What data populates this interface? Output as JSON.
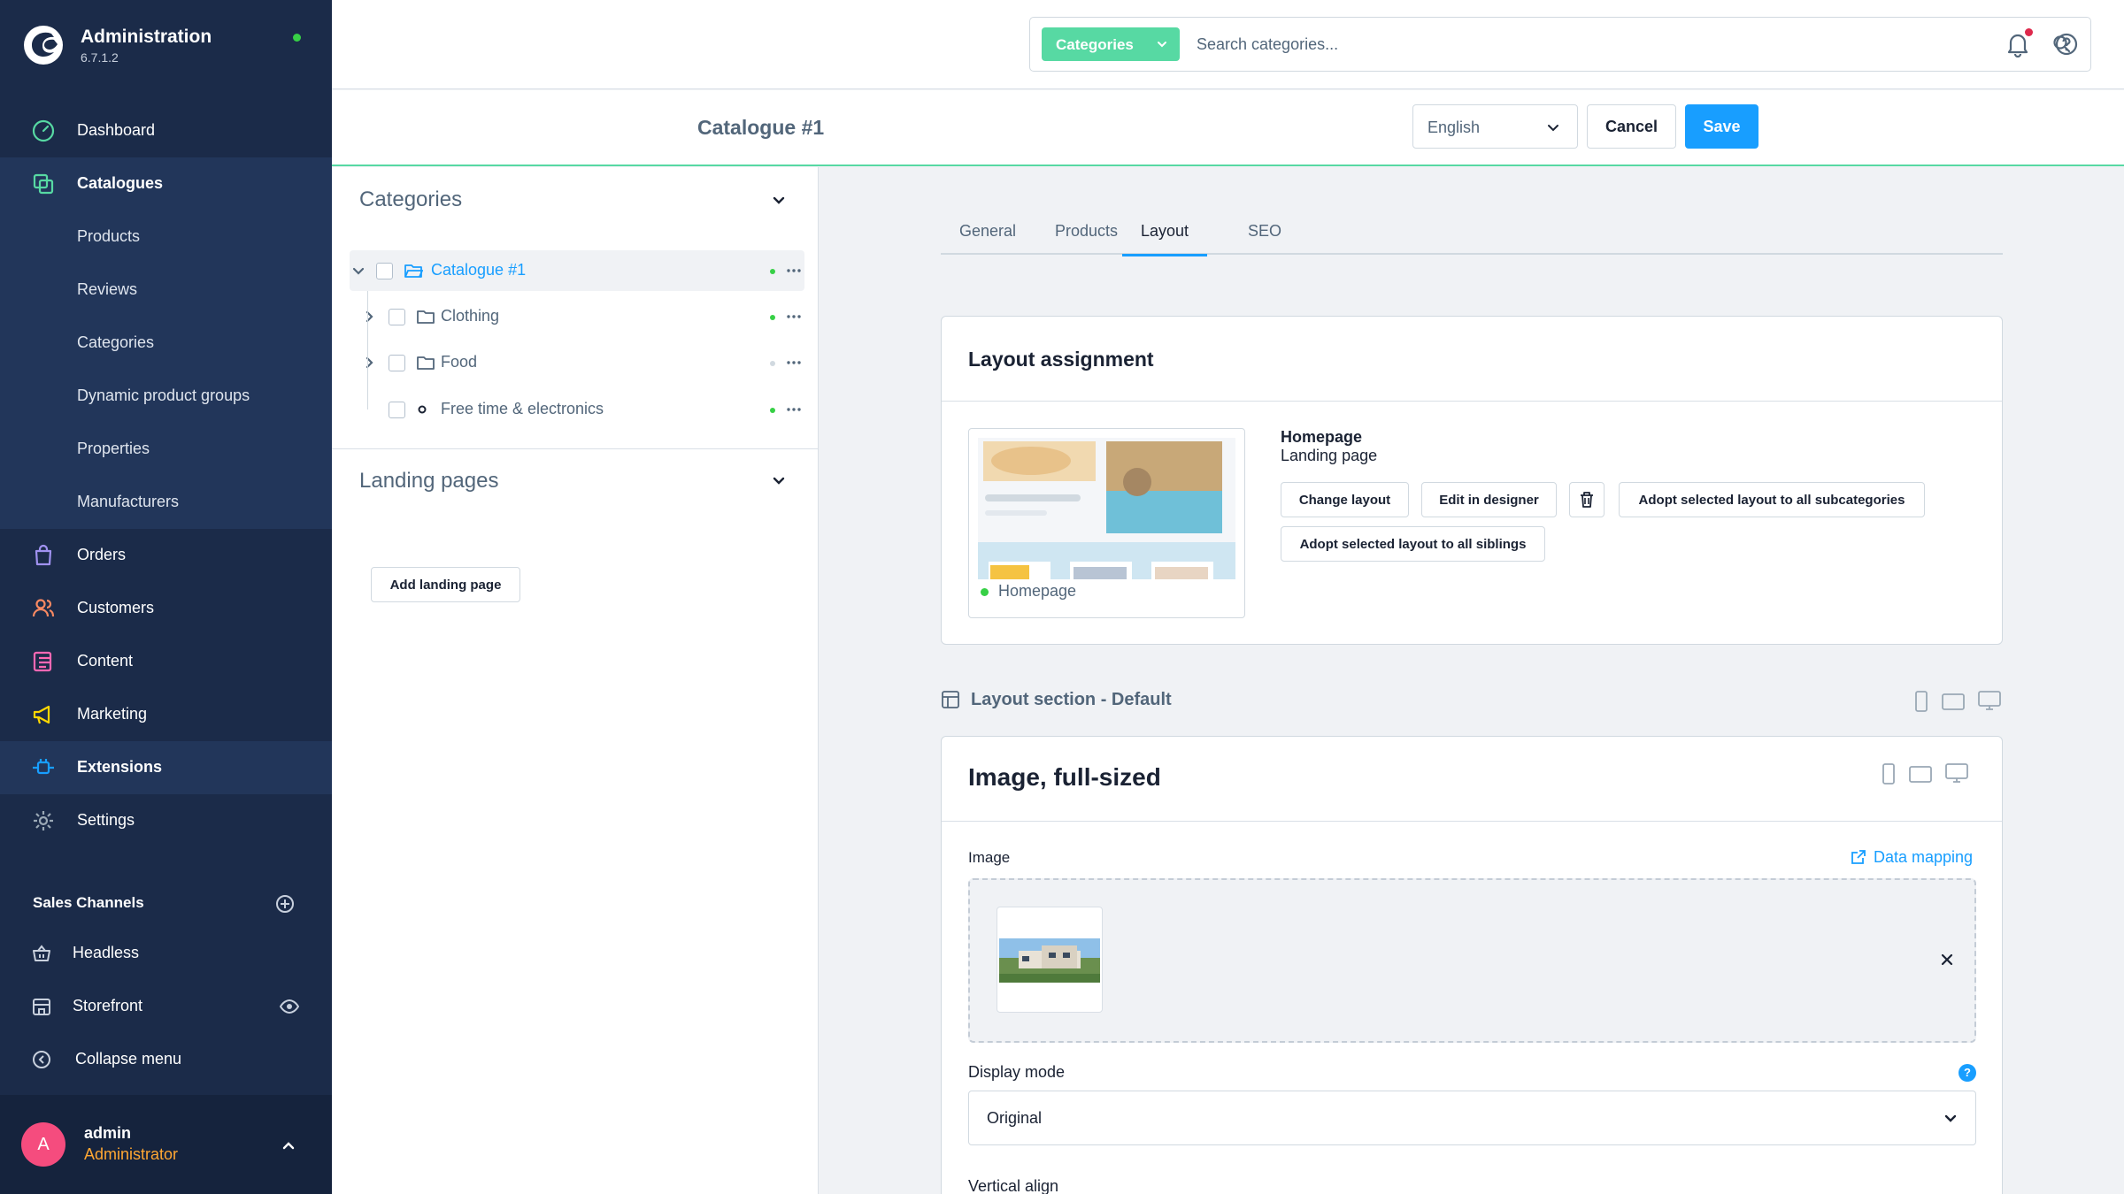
{
  "app": {
    "title": "Administration",
    "version": "6.7.1.2"
  },
  "nav": {
    "dashboard": "Dashboard",
    "catalogues": "Catalogues",
    "products": "Products",
    "reviews": "Reviews",
    "categories": "Categories",
    "dynamic_groups": "Dynamic product groups",
    "properties": "Properties",
    "manufacturers": "Manufacturers",
    "orders": "Orders",
    "customers": "Customers",
    "content": "Content",
    "marketing": "Marketing",
    "extensions": "Extensions",
    "settings": "Settings"
  },
  "sales_channels": {
    "title": "Sales Channels",
    "items": [
      "Headless",
      "Storefront"
    ],
    "collapse": "Collapse menu"
  },
  "user": {
    "initial": "A",
    "name": "admin",
    "role": "Administrator"
  },
  "search": {
    "type": "Categories",
    "placeholder": "Search categories..."
  },
  "smartbar": {
    "title": "Catalogue #1",
    "language": "English",
    "cancel": "Cancel",
    "save": "Save"
  },
  "tree": {
    "title": "Categories",
    "items": [
      {
        "label": "Catalogue #1",
        "active": true
      },
      {
        "label": "Clothing",
        "active": true
      },
      {
        "label": "Food",
        "active": false
      },
      {
        "label": "Free time & electronics",
        "active": true
      }
    ],
    "landing_title": "Landing pages",
    "add_landing": "Add landing page"
  },
  "tabs": [
    "General",
    "Products",
    "Layout",
    "SEO"
  ],
  "active_tab": "Layout",
  "layout_card": {
    "title": "Layout assignment",
    "preview_name": "Homepage",
    "layout_name": "Homepage",
    "layout_type": "Landing page",
    "buttons": {
      "change": "Change layout",
      "edit": "Edit in designer",
      "adopt_sub": "Adopt selected layout to all subcategories",
      "adopt_sib": "Adopt selected layout to all siblings"
    }
  },
  "section": {
    "title": "Layout section - Default"
  },
  "element_card": {
    "title": "Image, full-sized",
    "image_label": "Image",
    "data_mapping": "Data mapping",
    "display_mode_label": "Display mode",
    "display_mode_value": "Original",
    "vertical_align_label": "Vertical align"
  },
  "colors": {
    "sidebar": "#1b2b49",
    "accent": "#189eff",
    "brand_green": "#57d9a3",
    "status_green": "#37d046",
    "notification": "#de294c"
  },
  "icons": {
    "dashboard": "gauge-icon",
    "catalogues": "copy-icon",
    "orders": "shopping-bag-icon",
    "customers": "users-icon",
    "content": "content-list-icon",
    "marketing": "megaphone-icon",
    "extensions": "plug-icon",
    "settings": "gear-icon"
  }
}
